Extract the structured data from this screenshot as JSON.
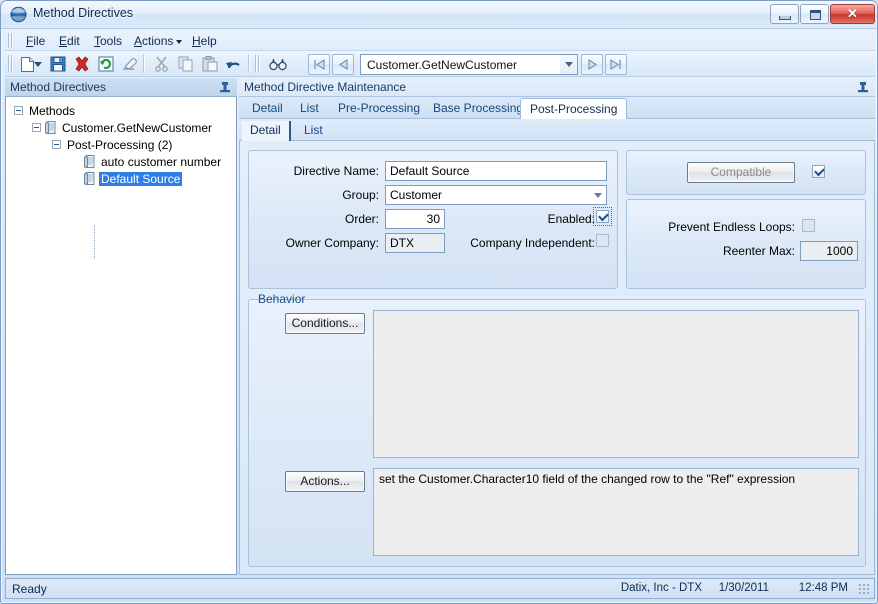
{
  "window": {
    "title": "Method Directives",
    "icon": "sphere-icon",
    "controls": {
      "minimize": "minimize",
      "maximize": "maximize",
      "close": "close"
    }
  },
  "menubar": {
    "items": [
      {
        "label": "File",
        "accel": "F"
      },
      {
        "label": "Edit",
        "accel": "E"
      },
      {
        "label": "Tools",
        "accel": "T"
      },
      {
        "label": "Actions",
        "accel": "A",
        "has_dropdown": true
      },
      {
        "label": "Help",
        "accel": "H"
      }
    ]
  },
  "toolbar": {
    "buttons": [
      {
        "name": "new-icon",
        "title": "New"
      },
      {
        "name": "new-dropdown-icon",
        "title": "New options"
      },
      {
        "name": "save-icon",
        "title": "Save"
      },
      {
        "name": "delete-icon",
        "title": "Delete"
      },
      {
        "name": "refresh-icon",
        "title": "Refresh"
      },
      {
        "name": "clear-icon",
        "title": "Clear"
      },
      {
        "name": "cut-icon",
        "title": "Cut"
      },
      {
        "name": "copy-icon",
        "title": "Copy"
      },
      {
        "name": "paste-icon",
        "title": "Paste"
      },
      {
        "name": "undo-icon",
        "title": "Undo"
      },
      {
        "name": "binoculars-icon",
        "title": "Search"
      }
    ],
    "nav": {
      "first": "first-record-icon",
      "previous": "previous-record-icon",
      "next": "next-record-icon",
      "last": "last-record-icon"
    },
    "record_combo": {
      "value": "Customer.GetNewCustomer"
    }
  },
  "left_panel": {
    "caption": "Method Directives",
    "pin": "pin-icon",
    "tree": [
      {
        "label": "Methods",
        "depth": 0,
        "expander": "minus",
        "icon": null,
        "selected": false
      },
      {
        "label": "Customer.GetNewCustomer",
        "depth": 1,
        "expander": "minus",
        "icon": "document-icon",
        "selected": false
      },
      {
        "label": "Post-Processing (2)",
        "depth": 2,
        "expander": "minus",
        "icon": null,
        "selected": false
      },
      {
        "label": "auto customer number",
        "depth": 3,
        "expander": null,
        "icon": "document-icon",
        "selected": false
      },
      {
        "label": "Default Source",
        "depth": 3,
        "expander": null,
        "icon": "document-icon",
        "selected": true
      }
    ]
  },
  "right_panel": {
    "caption": "Method Directive Maintenance",
    "pin": "pin-icon",
    "tabs": [
      {
        "label": "Detail",
        "active": false
      },
      {
        "label": "List",
        "active": false
      },
      {
        "label": "Pre-Processing",
        "active": false
      },
      {
        "label": "Base Processing",
        "active": false
      },
      {
        "label": "Post-Processing",
        "active": true
      }
    ],
    "subtabs": [
      {
        "label": "Detail",
        "active": true
      },
      {
        "label": "List",
        "active": false
      }
    ]
  },
  "form": {
    "directive_name": {
      "label": "Directive Name:",
      "value": "Default Source"
    },
    "group": {
      "label": "Group:",
      "value": "Customer"
    },
    "order": {
      "label": "Order:",
      "value": "30"
    },
    "owner_company": {
      "label": "Owner Company:",
      "value": "DTX"
    },
    "enabled": {
      "label": "Enabled:",
      "checked": true
    },
    "company_independent": {
      "label": "Company Independent:",
      "checked": false
    }
  },
  "options": {
    "compatible": {
      "label": "Compatible",
      "disabled": true,
      "checked": true
    },
    "prevent_endless_loops": {
      "label": "Prevent Endless Loops:",
      "checked": false
    },
    "reenter_max": {
      "label": "Reenter Max:",
      "value": "1000"
    }
  },
  "behavior": {
    "title": "Behavior",
    "conditions_button": "Conditions...",
    "conditions_text": "",
    "actions_button": "Actions...",
    "actions_text": "set the Customer.Character10 field of the changed row to the \"Ref\" expression"
  },
  "statusbar": {
    "message": "Ready",
    "company": "Datix, Inc - DTX",
    "date": "1/30/2011",
    "time": "12:48 PM"
  },
  "colors": {
    "selection_blue": "#2f7ee8",
    "frame_blue": "#7a9cc6",
    "text_blue": "#17457e",
    "close_red": "#c7342a"
  }
}
